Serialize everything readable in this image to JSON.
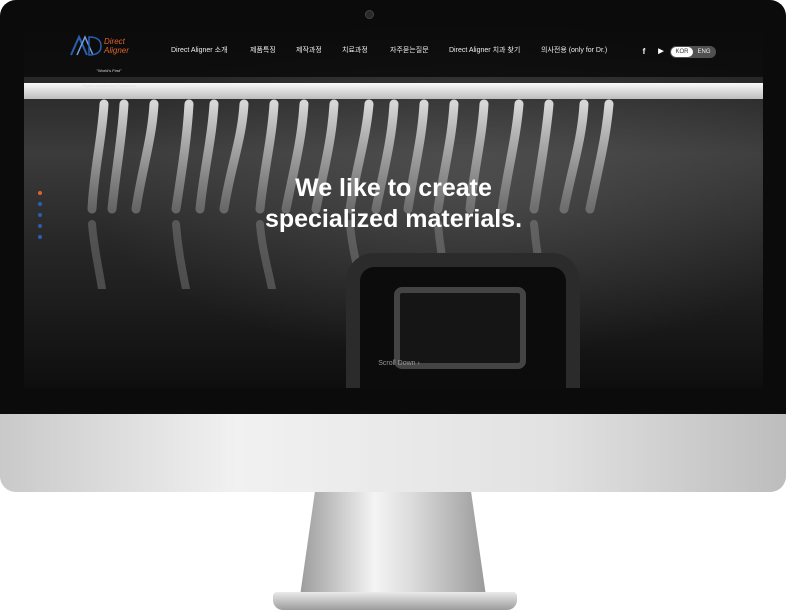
{
  "brand": {
    "name_line1": "Direct",
    "name_line2": "Aligner",
    "tagline_line1": "\"World's First\"",
    "tagline_line2": "Digital orthodontics Treatment",
    "accent_color": "#e0642a",
    "logo_color": "#2a5fb0"
  },
  "nav": {
    "items": [
      {
        "label": "Direct Aligner 소개"
      },
      {
        "label": "제품특징"
      },
      {
        "label": "제작과정"
      },
      {
        "label": "치료과정"
      },
      {
        "label": "자주묻는질문"
      },
      {
        "label": "Direct Aligner 치과 찾기"
      },
      {
        "label": "의사전용 (only for Dr.)"
      }
    ]
  },
  "social": {
    "facebook_icon": "f",
    "youtube_icon": "▶"
  },
  "language": {
    "selected": "KOR",
    "options": [
      "KOR",
      "ENG"
    ]
  },
  "hero": {
    "line1": "We like to create",
    "line2": "specialized materials.",
    "scroll_label": "Scroll Down ›"
  },
  "slider": {
    "count": 5,
    "active_index": 0
  }
}
